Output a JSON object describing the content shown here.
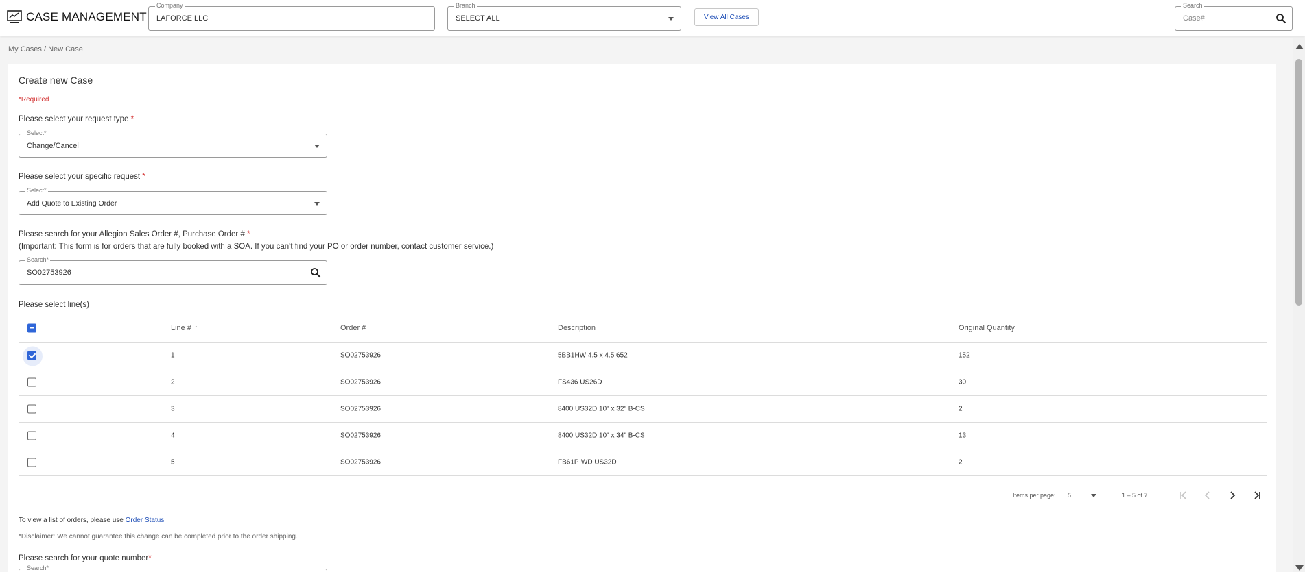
{
  "header": {
    "title": "CASE MANAGEMENT",
    "company": {
      "label": "Company",
      "value": "LAFORCE LLC"
    },
    "branch": {
      "label": "Branch",
      "value": "SELECT ALL"
    },
    "view_all_label": "View All Cases",
    "search": {
      "label": "Search",
      "placeholder": "Case#"
    }
  },
  "breadcrumb": {
    "parent": "My Cases",
    "separator": "/",
    "current": "New Case"
  },
  "form": {
    "title": "Create new Case",
    "required_note": "*Required",
    "request_type": {
      "question": "Please select your request type",
      "asterisk": "*",
      "field_label": "Select*",
      "value": "Change/Cancel"
    },
    "specific_request": {
      "question": "Please select your specific request",
      "asterisk": "*",
      "field_label": "Select*",
      "value": "Add Quote to Existing Order"
    },
    "order_search": {
      "question": "Please search for your Allegion Sales Order #, Purchase Order #",
      "asterisk": "*",
      "note": "(Important: This form is for orders that are fully booked with a SOA. If you can't find your PO or order number, contact customer service.)",
      "field_label": "Search*",
      "value": "SO02753926"
    },
    "lines_label": "Please select line(s)",
    "table": {
      "columns": [
        "Line #",
        "Order #",
        "Description",
        "Original Quantity"
      ],
      "sort_indicator": "↑",
      "rows": [
        {
          "line": "1",
          "order": "SO02753926",
          "description": "5BB1HW 4.5 x 4.5 652",
          "quantity": "152",
          "checked": true
        },
        {
          "line": "2",
          "order": "SO02753926",
          "description": "FS436 US26D",
          "quantity": "30",
          "checked": false
        },
        {
          "line": "3",
          "order": "SO02753926",
          "description": "8400 US32D 10\" x 32\" B-CS",
          "quantity": "2",
          "checked": false
        },
        {
          "line": "4",
          "order": "SO02753926",
          "description": "8400 US32D 10\" x 34\" B-CS",
          "quantity": "13",
          "checked": false
        },
        {
          "line": "5",
          "order": "SO02753926",
          "description": "FB61P-WD US32D",
          "quantity": "2",
          "checked": false
        }
      ]
    },
    "paginator": {
      "items_per_page_label": "Items per page:",
      "page_size": "5",
      "range": "1 – 5 of 7"
    },
    "order_status_note": {
      "prefix": "To view a list of orders, please use ",
      "link": "Order Status"
    },
    "disclaimer": "*Disclaimer: We cannot guarantee this change can be completed prior to the order shipping.",
    "quote_search": {
      "question": "Please search for your quote number",
      "asterisk": "*",
      "field_label": "Search*"
    }
  },
  "colors": {
    "accent": "#2f66d8",
    "link": "#1f4fb7",
    "required": "#d32f2f"
  }
}
